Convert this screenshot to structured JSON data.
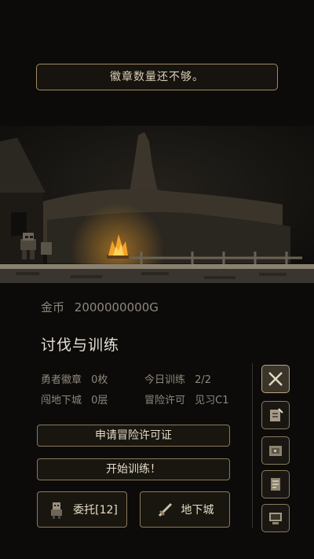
{
  "toast": {
    "message": "徽章数量还不够。"
  },
  "currency": {
    "label": "金币",
    "value": "2000000000G"
  },
  "section": {
    "title": "讨伐与训练"
  },
  "stats": {
    "badge_label": "勇者徽章",
    "badge_value": "0枚",
    "training_label": "今日训练",
    "training_value": "2/2",
    "dungeon_label": "闯地下城",
    "dungeon_value": "0层",
    "license_label": "冒险许可",
    "license_value": "见习C1"
  },
  "buttons": {
    "apply_license": "申请冒险许可证",
    "start_training": "开始训练！",
    "commission": "委托[12]",
    "dungeon": "地下城"
  },
  "side_menu": {
    "icons": [
      "crossed-swords-icon",
      "scroll-quill-icon",
      "map-scroll-icon",
      "document-icon",
      "computer-icon"
    ],
    "active_index": 0
  },
  "colors": {
    "accent": "#a08a62",
    "fire": "#f2a32a",
    "text_dim": "#8f877a"
  }
}
